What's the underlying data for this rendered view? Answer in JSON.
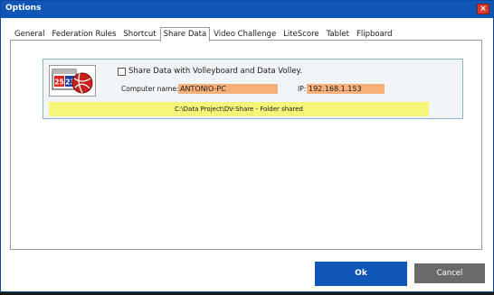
{
  "window": {
    "title": "Options",
    "close_label": "×"
  },
  "tabs": [
    {
      "label": "General",
      "active": false
    },
    {
      "label": "Federation Rules",
      "active": false
    },
    {
      "label": "Shortcut",
      "active": false
    },
    {
      "label": "Share Data",
      "active": true
    },
    {
      "label": "Video Challenge",
      "active": false
    },
    {
      "label": "LiteScore",
      "active": false
    },
    {
      "label": "Tablet",
      "active": false
    },
    {
      "label": "Flipboard",
      "active": false
    }
  ],
  "share": {
    "checkbox_label": "Share Data with Volleyboard and Data Volley.",
    "checked": false,
    "computer_name_label": "Computer name:",
    "computer_name_value": "ANTONIO-PC",
    "ip_label": "IP:",
    "ip_value": "192.168.1.153",
    "status": "C:\\Data Project\\DV-Share - Folder shared"
  },
  "logo": {
    "calendar_left": "25",
    "calendar_right": "23",
    "icon": "volleyball-calendar-icon"
  },
  "buttons": {
    "ok": "Ok",
    "cancel": "Cancel"
  },
  "colors": {
    "accent": "#0f56b7",
    "field_bg": "#f7b07a",
    "status_bg": "#f5f57a",
    "cancel_bg": "#6a6a6a",
    "close_bg": "#d83a2e"
  }
}
